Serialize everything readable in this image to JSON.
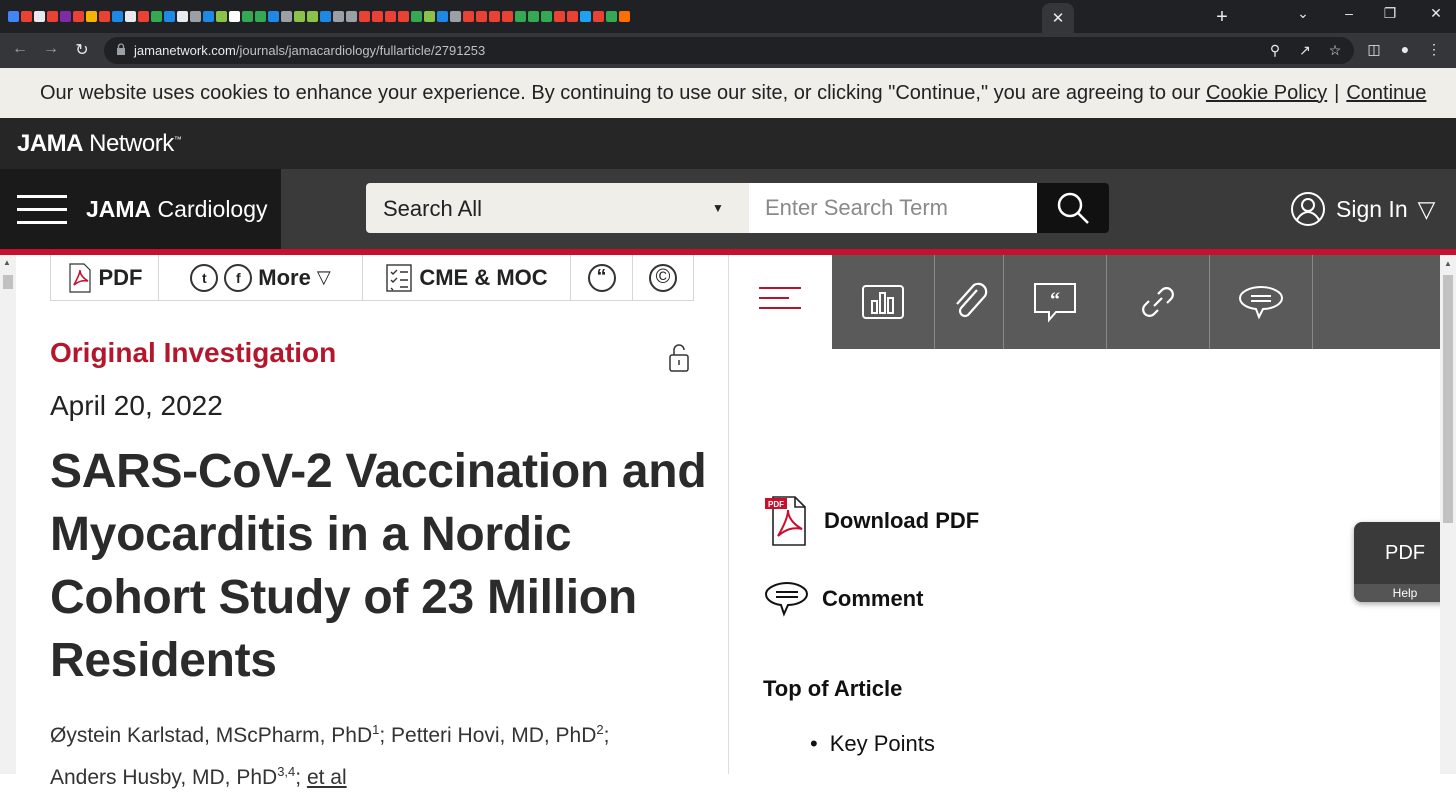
{
  "browser": {
    "url_host": "jamanetwork.com",
    "url_path": "/journals/jamacardiology/fullarticle/2791253",
    "tab_close": "✕",
    "new_tab": "+",
    "window_controls": [
      "⌄",
      "–",
      "❐",
      "✕"
    ],
    "favicon_colors": [
      "#4285f4",
      "#e94235",
      "#e8eaed",
      "#e94235",
      "#7e2aa9",
      "#e94235",
      "#f4b400",
      "#e94235",
      "#1e88e5",
      "#e8eaed",
      "#e94235",
      "#34a853",
      "#1e88e5",
      "#e8eaed",
      "#9aa0a6",
      "#1e88e5",
      "#8bc34a",
      "#ffffff",
      "#34a853",
      "#34a853",
      "#1e88e5",
      "#9aa0a6",
      "#8bc34a",
      "#8bc34a",
      "#1e88e5",
      "#9aa0a6",
      "#9aa0a6",
      "#e94235",
      "#e94235",
      "#e94235",
      "#e94235",
      "#34a853",
      "#8bc34a",
      "#1e88e5",
      "#9aa0a6",
      "#e94235",
      "#e94235",
      "#e94235",
      "#e94235",
      "#34a853",
      "#34a853",
      "#34a853",
      "#e94235",
      "#e94235",
      "#1da1f2",
      "#e94235",
      "#34a853",
      "#ff6f00"
    ]
  },
  "cookie": {
    "text": "Our website uses cookies to enhance your experience. By continuing to use our site, or clicking \"Continue,\" you are agreeing to our",
    "policy_link": "Cookie Policy",
    "pipe": "|",
    "continue_link": "Continue"
  },
  "network": {
    "logo_bold": "JAMA",
    "logo_rest": " Network",
    "logo_tm": "™"
  },
  "journal": {
    "name_bold": "JAMA",
    "name_rest": " Cardiology",
    "search_scope": "Search All",
    "search_placeholder": "Enter Search Term",
    "signin": "Sign In",
    "signin_caret": "▽"
  },
  "article_tools": {
    "pdf": "PDF",
    "more": "More",
    "more_caret": "▽",
    "twitter_glyph": "t",
    "facebook_glyph": "f",
    "cme": "CME & MOC",
    "quote_glyph": "“",
    "copyright_glyph": "©"
  },
  "article": {
    "category": "Original Investigation",
    "date": "April 20, 2022",
    "title": "SARS-CoV-2 Vaccination and Myocarditis in a Nordic Cohort Study of 23 Million Residents",
    "author1": "Øystein Karlstad, MScPharm, PhD",
    "author1_sup": "1",
    "author2": "; Petteri Hovi, MD, PhD",
    "author2_sup": "2",
    "author2_tail": ";",
    "author3": "Anders Husby, MD, PhD",
    "author3_sup": "3,4",
    "author3_tail": "; ",
    "etal": "et al"
  },
  "right_panel": {
    "download_pdf": "Download PDF",
    "pdf_badge": "PDF",
    "comment": "Comment",
    "top_of_article": "Top of Article",
    "key_points": "Key Points"
  },
  "pdf_widget": {
    "label": "PDF",
    "help": "Help"
  },
  "colors": {
    "accent_red": "#b5162c",
    "nav_dark": "#262626",
    "red_rule": "#c8102e"
  }
}
